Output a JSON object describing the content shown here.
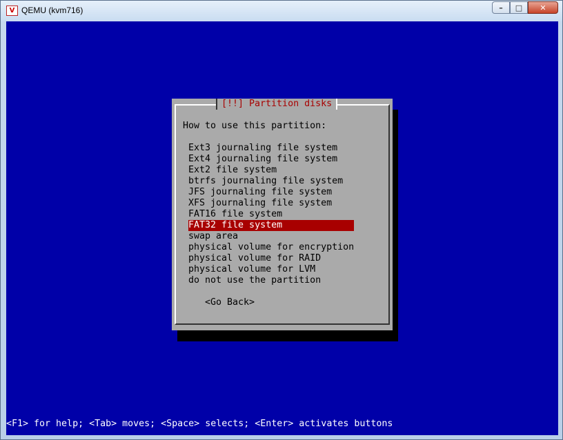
{
  "window": {
    "title": "QEMU (kvm716)",
    "app_icon": "V",
    "minimize": "–",
    "maximize": "□",
    "close": "✕"
  },
  "dialog": {
    "title": "[!!] Partition disks",
    "prompt": "How to use this partition:",
    "options": [
      "Ext3 journaling file system",
      "Ext4 journaling file system",
      "Ext2 file system",
      "btrfs journaling file system",
      "JFS journaling file system",
      "XFS journaling file system",
      "FAT16 file system",
      "FAT32 file system",
      "swap area",
      "physical volume for encryption",
      "physical volume for RAID",
      "physical volume for LVM",
      "do not use the partition"
    ],
    "selected_index": 7,
    "go_back": "<Go Back>"
  },
  "help_line": "<F1> for help; <Tab> moves; <Space> selects; <Enter> activates buttons",
  "colors": {
    "console_bg": "#0000a8",
    "dialog_bg": "#aaaaaa",
    "title_fg": "#a80000",
    "selection_bg": "#a80000"
  }
}
